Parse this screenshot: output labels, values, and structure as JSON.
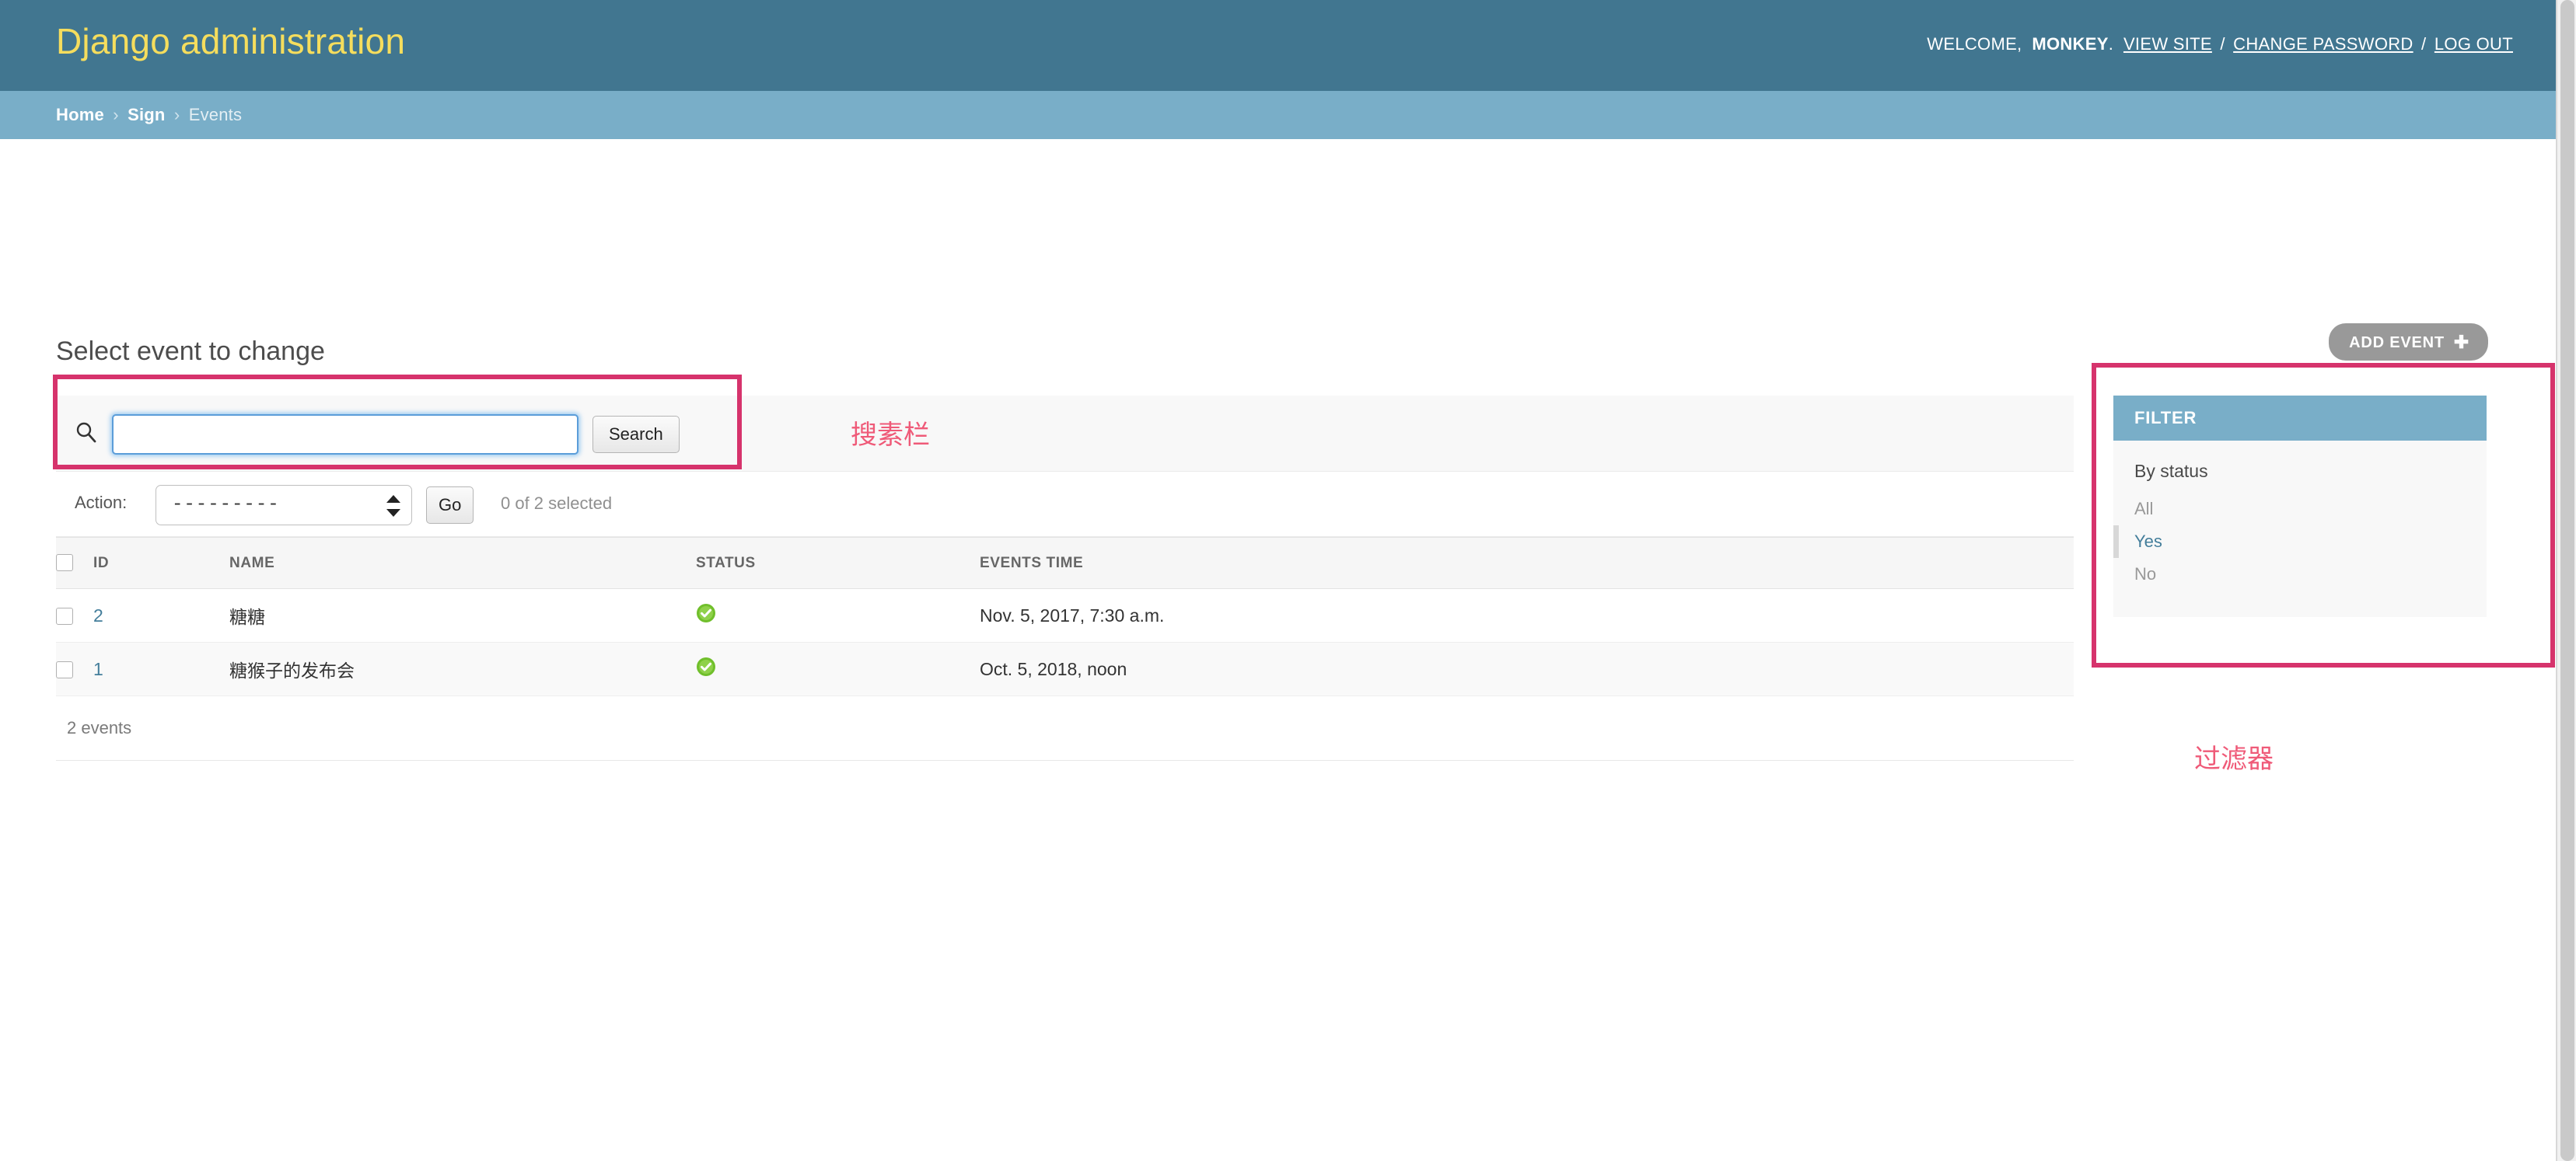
{
  "header": {
    "brand": "Django administration",
    "welcome_prefix": "WELCOME,",
    "username": "MONKEY",
    "username_suffix": ".",
    "links": [
      {
        "label": "VIEW SITE"
      },
      {
        "label": "CHANGE PASSWORD"
      },
      {
        "label": "LOG OUT"
      }
    ],
    "separator": "/"
  },
  "breadcrumbs": {
    "items": [
      {
        "label": "Home",
        "current": false
      },
      {
        "label": "Sign",
        "current": false
      },
      {
        "label": "Events",
        "current": true
      }
    ],
    "separator": "›"
  },
  "main": {
    "page_title": "Select event to change",
    "add_button_label": "ADD EVENT",
    "add_button_icon": "plus-icon"
  },
  "search": {
    "value": "",
    "placeholder": "",
    "submit_label": "Search",
    "icon": "search-icon"
  },
  "actions": {
    "label": "Action:",
    "selected_option": "---------",
    "options": [
      "---------"
    ],
    "go_label": "Go",
    "counter": "0 of 2 selected"
  },
  "table": {
    "columns": [
      "ID",
      "NAME",
      "STATUS",
      "EVENTS TIME"
    ],
    "rows": [
      {
        "id": "2",
        "name": "糖糖",
        "status_icon": "check-circle-green-icon",
        "time": "Nov. 5, 2017, 7:30 a.m."
      },
      {
        "id": "1",
        "name": "糖猴子的发布会",
        "status_icon": "check-circle-green-icon",
        "time": "Oct. 5, 2018, noon"
      }
    ],
    "paginator": "2 events"
  },
  "filter": {
    "header": "FILTER",
    "title": "By status",
    "choices": [
      {
        "label": "All",
        "selected": false
      },
      {
        "label": "Yes",
        "selected": true
      },
      {
        "label": "No",
        "selected": false
      }
    ]
  },
  "annotations": {
    "search_label": "搜素栏",
    "filter_label": "过滤器"
  },
  "colors": {
    "header_bg": "#417690",
    "breadcrumb_bg": "#79aec8",
    "brand_text": "#f5dd5d",
    "link_blue": "#447e9b",
    "annotation_red": "#d6336c",
    "annotation_text": "#ef5a78",
    "status_green": "#70bf2b",
    "add_button_bg": "#999999"
  }
}
